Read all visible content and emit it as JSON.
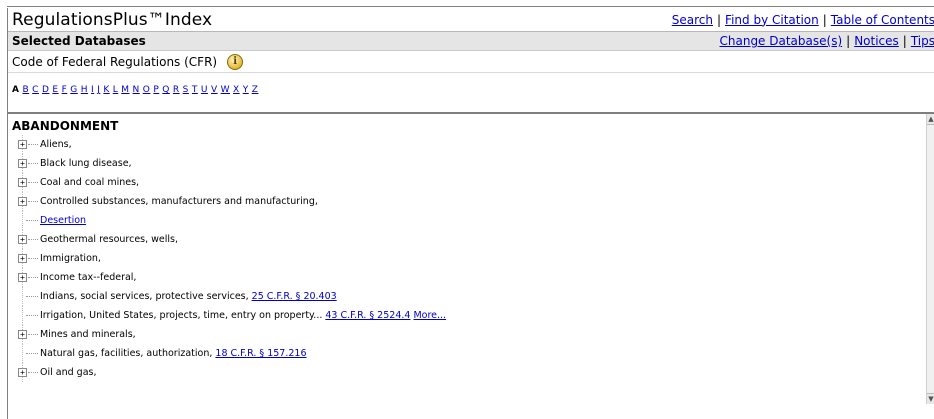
{
  "header": {
    "title": "RegulationsPlus™Index",
    "links": [
      "Search",
      "Find by Citation",
      "Table of Contents"
    ]
  },
  "selected_bar": {
    "label": "Selected Databases",
    "links": [
      "Change Database(s)",
      "Notices",
      "Tips"
    ]
  },
  "database": {
    "name": "Code of Federal Regulations (CFR)",
    "info_icon": "info-icon"
  },
  "alphabet": {
    "current": "A",
    "letters": [
      "B",
      "C",
      "D",
      "E",
      "F",
      "G",
      "H",
      "I",
      "J",
      "K",
      "L",
      "M",
      "N",
      "O",
      "P",
      "Q",
      "R",
      "S",
      "T",
      "U",
      "V",
      "W",
      "X",
      "Y",
      "Z"
    ]
  },
  "index": {
    "heading": "ABANDONMENT",
    "items": [
      {
        "text": "Aliens,"
      },
      {
        "text": "Black lung disease,"
      },
      {
        "text": "Coal and coal mines,"
      },
      {
        "text": "Controlled substances, manufacturers and manufacturing,"
      },
      {
        "link": "Desertion"
      },
      {
        "text": "Geothermal resources, wells,"
      },
      {
        "text": "Immigration,"
      },
      {
        "text": "Income tax--federal,"
      },
      {
        "text": "Indians, social services, protective services, ",
        "link": "25 C.F.R. § 20.403"
      },
      {
        "text": "Irrigation, United States, projects, time, entry on property... ",
        "link": "43 C.F.R. § 2524.4",
        "more": "More..."
      },
      {
        "text": "Mines and minerals,"
      },
      {
        "text": "Natural gas, facilities, authorization, ",
        "link": "18 C.F.R. § 157.216"
      },
      {
        "text": "Oil and gas,"
      }
    ]
  }
}
